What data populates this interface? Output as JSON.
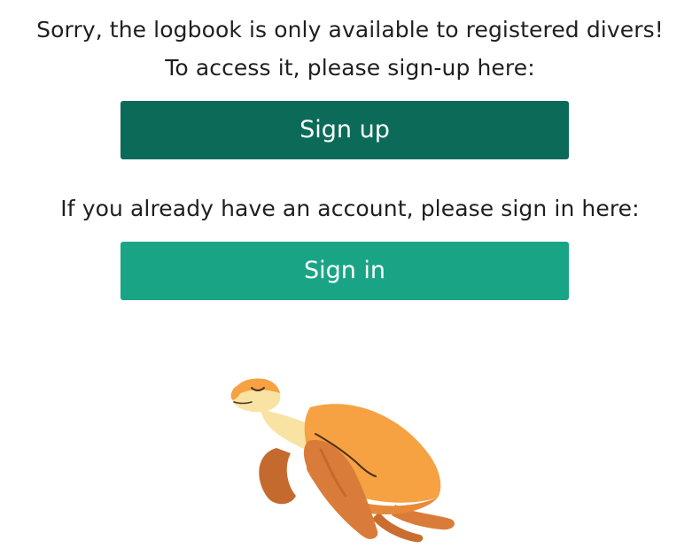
{
  "message": {
    "line1": "Sorry, the logbook is only available to registered divers!",
    "line2": "To access it, please sign-up here:",
    "line3": "If you already have an account, please sign in here:"
  },
  "buttons": {
    "signup_label": "Sign up",
    "signin_label": "Sign in"
  },
  "colors": {
    "signup": "#0b6b58",
    "signin": "#1aa486",
    "turtle_shell": "#f6a142",
    "turtle_flipper": "#d97c3a",
    "turtle_head": "#f9e3a3"
  },
  "illustration": {
    "icon": "turtle-illustration"
  }
}
